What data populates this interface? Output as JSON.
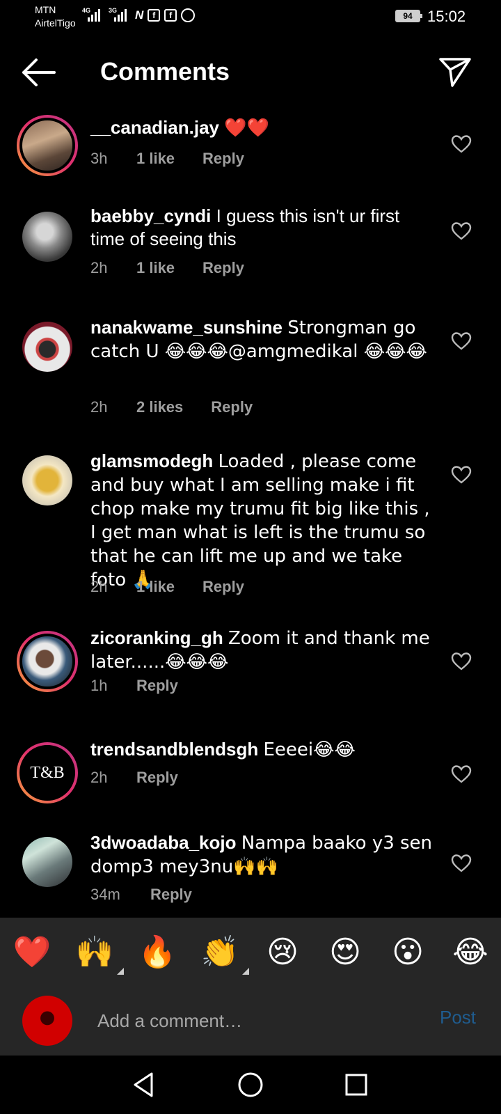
{
  "status_bar": {
    "carrier_1": "MTN",
    "carrier_2": "AirtelTigo",
    "network_1": "4G",
    "network_2": "3G",
    "battery": "94",
    "time": "15:02"
  },
  "header": {
    "title": "Comments"
  },
  "comments": [
    {
      "username": "__canadian.jay",
      "text": "❤️❤️",
      "time": "3h",
      "likes": "1 like",
      "reply": "Reply",
      "avatar_ring": true
    },
    {
      "username": "baebby_cyndi",
      "text": "I guess this isn't ur first time of seeing this",
      "time": "2h",
      "likes": "1 like",
      "reply": "Reply",
      "avatar_ring": false
    },
    {
      "username": "nanakwame_sunshine",
      "text": "Strongman go catch U 😂😂😂@amgmedikal 😂😂😂",
      "time": "2h",
      "likes": "2 likes",
      "reply": "Reply",
      "avatar_ring": false
    },
    {
      "username": "glamsmodegh",
      "text": "Loaded , please come and buy what I am selling make i fit chop make my trumu fit big like this , I get man what is left is the trumu so that he can lift me up and we take foto 🙏",
      "time": "2h",
      "likes": "1 like",
      "reply": "Reply",
      "avatar_ring": false
    },
    {
      "username": "zicoranking_gh",
      "text": "Zoom it and thank me later......😂😂😂",
      "time": "1h",
      "likes": "",
      "reply": "Reply",
      "avatar_ring": true
    },
    {
      "username": "trendsandblendsgh",
      "text": "Eeeei😂😂",
      "time": "2h",
      "likes": "",
      "reply": "Reply",
      "avatar_ring": true,
      "avatar_text": "T&B"
    },
    {
      "username": "3dwoadaba_kojo",
      "text": "Nampa baako y3 sen domp3 mey3nu🙌🙌",
      "time": "34m",
      "likes": "",
      "reply": "Reply",
      "avatar_ring": false
    }
  ],
  "reactions": [
    "❤️",
    "🙌",
    "🔥",
    "👏",
    "😢",
    "😍",
    "😮",
    "😂"
  ],
  "input": {
    "placeholder": "Add a comment…",
    "post_label": "Post"
  },
  "colors": {
    "background": "#000000",
    "meta_text": "#9e9e9e",
    "bar_background": "#262626",
    "post_disabled": "#1f5c8f",
    "heart_red": "#e0202a"
  }
}
